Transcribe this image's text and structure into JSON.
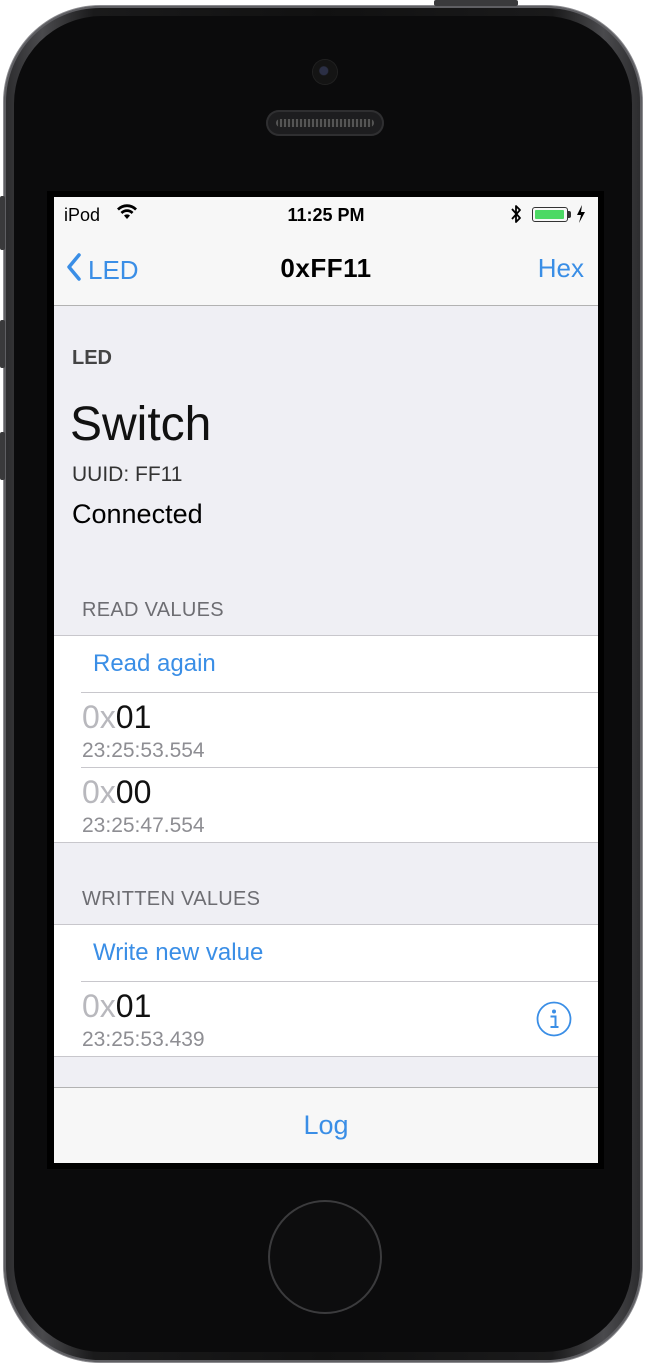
{
  "status_bar": {
    "carrier": "iPod",
    "time": "11:25 PM"
  },
  "nav": {
    "back_label": "LED",
    "title": "0xFF11",
    "right_label": "Hex"
  },
  "header": {
    "service_name": "LED",
    "characteristic_name": "Switch",
    "uuid": "UUID: FF11",
    "status": "Connected"
  },
  "read_values": {
    "header": "READ VALUES",
    "action_label": "Read again",
    "items": [
      {
        "prefix": "0x",
        "value": "01",
        "timestamp": "23:25:53.554"
      },
      {
        "prefix": "0x",
        "value": "00",
        "timestamp": "23:25:47.554"
      }
    ]
  },
  "written_values": {
    "header": "WRITTEN VALUES",
    "action_label": "Write new value",
    "items": [
      {
        "prefix": "0x",
        "value": "01",
        "timestamp": "23:25:53.439"
      }
    ]
  },
  "toolbar": {
    "log_label": "Log"
  },
  "colors": {
    "accent": "#3a8ee6",
    "background": "#efeff4",
    "battery": "#4cd964"
  },
  "battery_level": 1.0,
  "icons": [
    "wifi-icon",
    "bluetooth-icon",
    "battery-icon",
    "charging-icon",
    "back-chevron-icon",
    "info-icon"
  ]
}
